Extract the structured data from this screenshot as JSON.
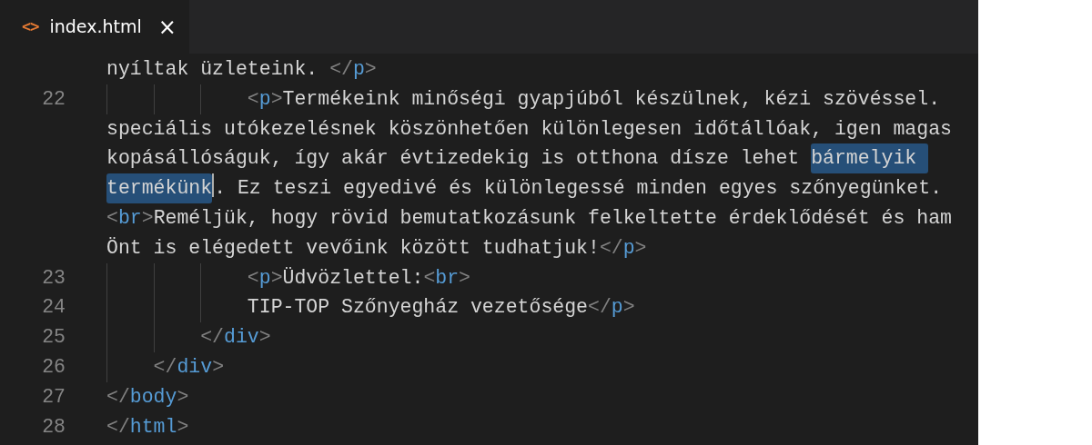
{
  "tab": {
    "icon": "<>",
    "label": "index.html",
    "close": "×",
    "selected": true
  },
  "rows": [
    {
      "tokens": [
        {
          "kind": "text",
          "text": "nyíltak üzleteink. ",
          "selected": false
        },
        {
          "kind": "punct",
          "text": "</",
          "selected": false
        },
        {
          "kind": "tag",
          "text": "p",
          "selected": false
        },
        {
          "kind": "punct",
          "text": ">",
          "selected": false
        }
      ]
    },
    {
      "number": "22",
      "indent": "            ",
      "tokens": [
        {
          "kind": "punct",
          "text": "<",
          "selected": false
        },
        {
          "kind": "tag",
          "text": "p",
          "selected": false
        },
        {
          "kind": "punct",
          "text": ">",
          "selected": false
        },
        {
          "kind": "text",
          "text": "Termékeink minőségi gyapjúból készülnek, kézi szövéssel.",
          "selected": false
        }
      ]
    },
    {
      "tokens": [
        {
          "kind": "text",
          "text": "speciális utókezelésnek köszönhetően különlegesen időtállóak, igen magas",
          "selected": false
        }
      ]
    },
    {
      "tokens": [
        {
          "kind": "text",
          "text": "kopásállóságuk, így akár évtizedekig is otthona dísze lehet ",
          "selected": false
        },
        {
          "kind": "text",
          "text": "bármelyik ",
          "selected": true
        }
      ]
    },
    {
      "tokens": [
        {
          "kind": "text",
          "text": "termékünk",
          "selected": true,
          "caret": true
        },
        {
          "kind": "text",
          "text": ". Ez teszi egyedivé és különlegessé minden egyes szőnyegünket.",
          "selected": false
        }
      ]
    },
    {
      "tokens": [
        {
          "kind": "punct",
          "text": "<",
          "selected": false
        },
        {
          "kind": "tag",
          "text": "br",
          "selected": false
        },
        {
          "kind": "punct",
          "text": ">",
          "selected": false
        },
        {
          "kind": "text",
          "text": "Reméljük, hogy rövid bemutatkozásunk felkeltette érdeklődését és ham",
          "selected": false
        }
      ]
    },
    {
      "tokens": [
        {
          "kind": "text",
          "text": "Önt is elégedett vevőink között tudhatjuk!",
          "selected": false
        },
        {
          "kind": "punct",
          "text": "</",
          "selected": false
        },
        {
          "kind": "tag",
          "text": "p",
          "selected": false
        },
        {
          "kind": "punct",
          "text": ">",
          "selected": false
        }
      ]
    },
    {
      "number": "23",
      "indent": "            ",
      "tokens": [
        {
          "kind": "punct",
          "text": "<",
          "selected": false
        },
        {
          "kind": "tag",
          "text": "p",
          "selected": false
        },
        {
          "kind": "punct",
          "text": ">",
          "selected": false
        },
        {
          "kind": "text",
          "text": "Üdvözlettel:",
          "selected": false
        },
        {
          "kind": "punct",
          "text": "<",
          "selected": false
        },
        {
          "kind": "tag",
          "text": "br",
          "selected": false
        },
        {
          "kind": "punct",
          "text": ">",
          "selected": false
        }
      ]
    },
    {
      "number": "24",
      "indent": "            ",
      "tokens": [
        {
          "kind": "text",
          "text": "TIP-TOP Szőnyegház vezetősége",
          "selected": false
        },
        {
          "kind": "punct",
          "text": "</",
          "selected": false
        },
        {
          "kind": "tag",
          "text": "p",
          "selected": false
        },
        {
          "kind": "punct",
          "text": ">",
          "selected": false
        }
      ]
    },
    {
      "number": "25",
      "indent": "        ",
      "tokens": [
        {
          "kind": "punct",
          "text": "</",
          "selected": false
        },
        {
          "kind": "tag",
          "text": "div",
          "selected": false
        },
        {
          "kind": "punct",
          "text": ">",
          "selected": false
        }
      ]
    },
    {
      "number": "26",
      "indent": "    ",
      "tokens": [
        {
          "kind": "punct",
          "text": "</",
          "selected": false
        },
        {
          "kind": "tag",
          "text": "div",
          "selected": false
        },
        {
          "kind": "punct",
          "text": ">",
          "selected": false
        }
      ]
    },
    {
      "number": "27",
      "tokens": [
        {
          "kind": "punct",
          "text": "</",
          "selected": false
        },
        {
          "kind": "tag",
          "text": "body",
          "selected": false
        },
        {
          "kind": "punct",
          "text": ">",
          "selected": false
        }
      ]
    },
    {
      "number": "28",
      "tokens": [
        {
          "kind": "punct",
          "text": "</",
          "selected": false
        },
        {
          "kind": "tag",
          "text": "html",
          "selected": false
        },
        {
          "kind": "punct",
          "text": ">",
          "selected": false
        }
      ]
    }
  ]
}
